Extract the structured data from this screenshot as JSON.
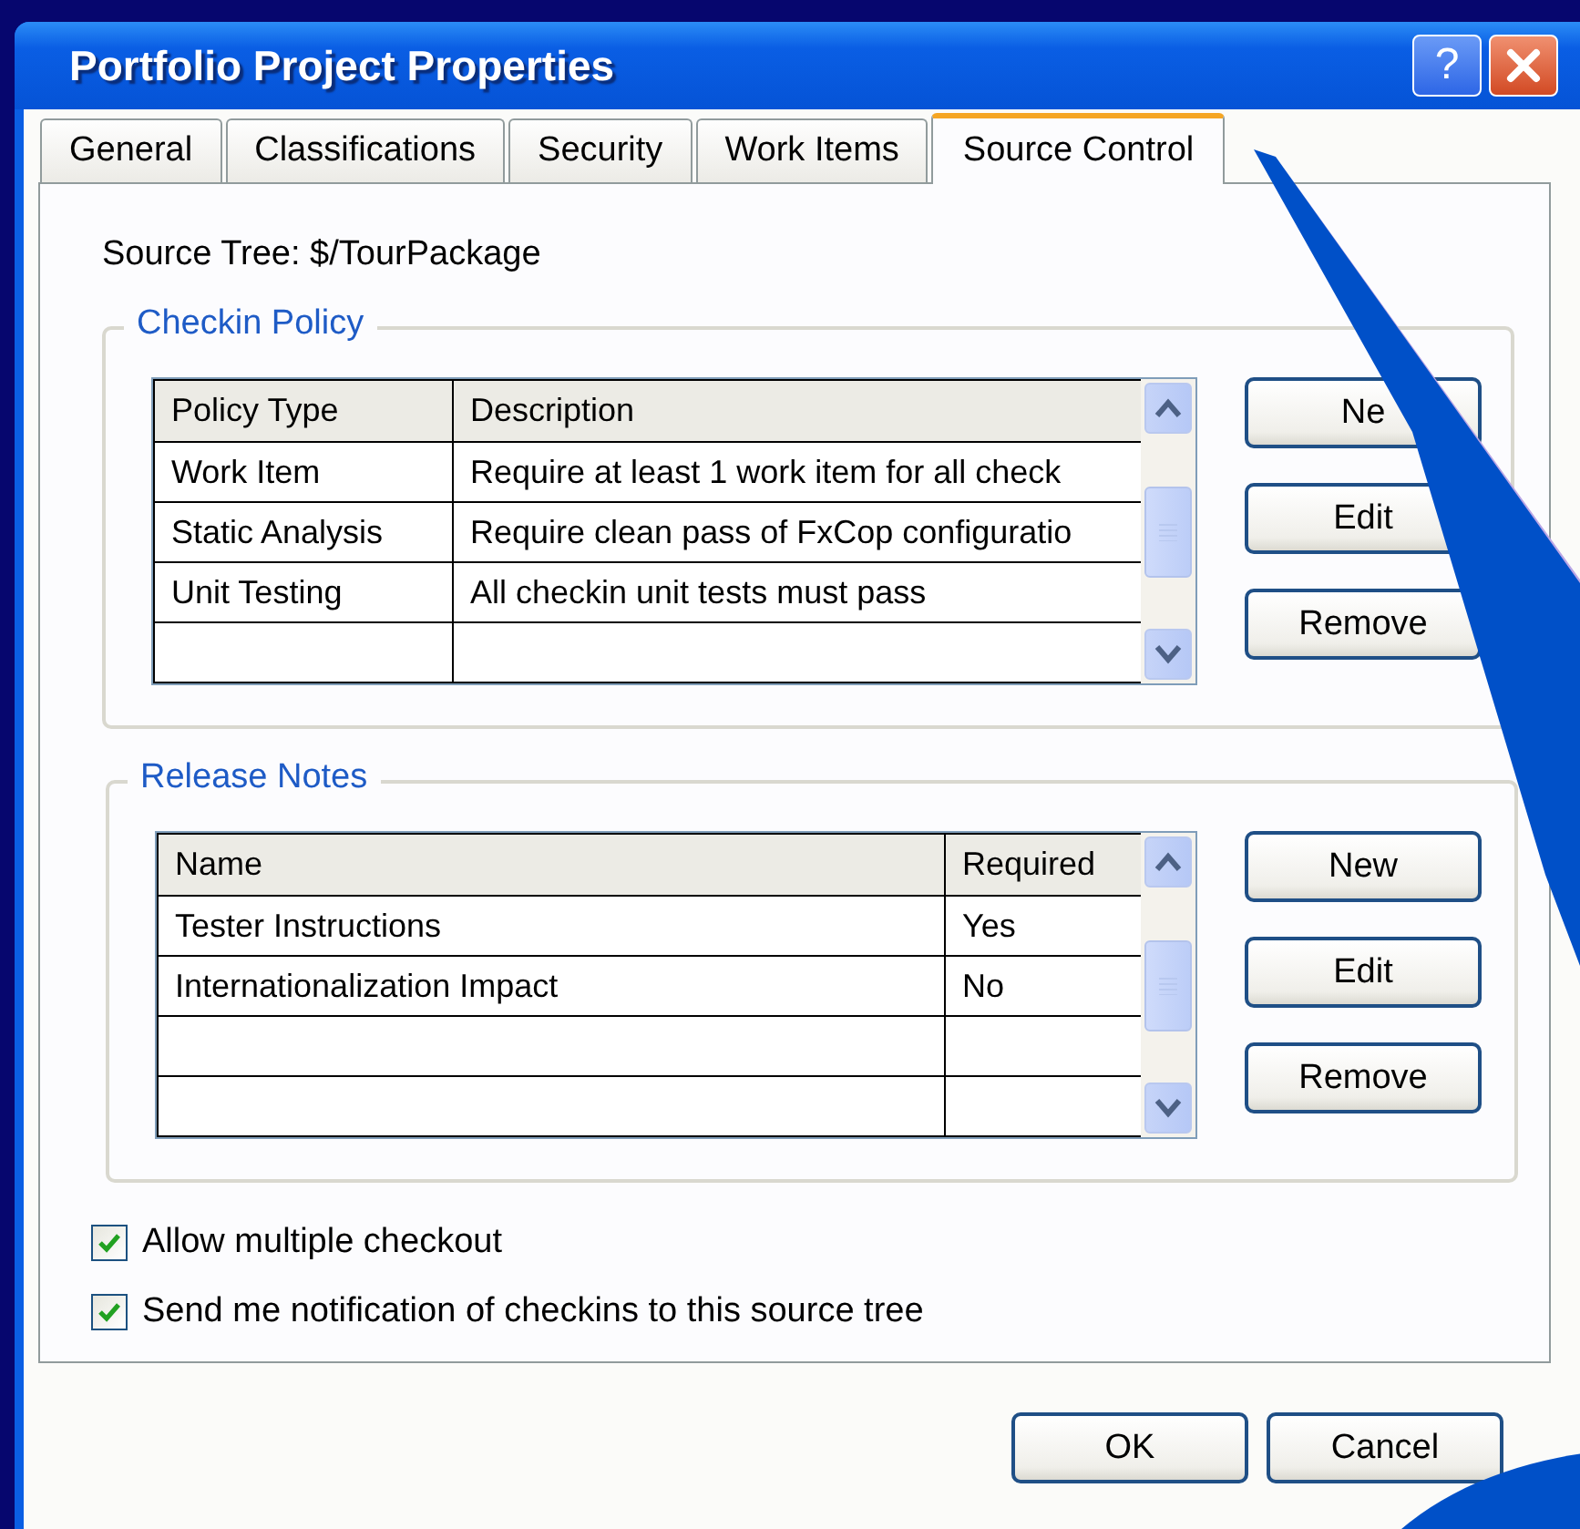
{
  "window": {
    "title": "Portfolio Project Properties",
    "help_button": "?"
  },
  "tabs": [
    {
      "label": "General",
      "selected": false
    },
    {
      "label": "Classifications",
      "selected": false
    },
    {
      "label": "Security",
      "selected": false
    },
    {
      "label": "Work Items",
      "selected": false
    },
    {
      "label": "Source Control",
      "selected": true
    }
  ],
  "source_tree": "Source Tree: $/TourPackage",
  "checkin_policy": {
    "title": "Checkin Policy",
    "columns": [
      "Policy Type",
      "Description"
    ],
    "rows": [
      [
        "Work Item",
        "Require at least 1 work item for all check"
      ],
      [
        "Static Analysis",
        "Require clean pass of FxCop configuratio"
      ],
      [
        "Unit Testing",
        "All checkin unit tests must pass"
      ]
    ],
    "buttons": [
      "Ne",
      "Edit",
      "Remove"
    ]
  },
  "release_notes": {
    "title": "Release Notes",
    "columns": [
      "Name",
      "Required"
    ],
    "rows": [
      [
        "Tester Instructions",
        "Yes"
      ],
      [
        "Internationalization Impact",
        "No"
      ]
    ],
    "buttons": [
      "New",
      "Edit",
      "Remove"
    ]
  },
  "options": [
    {
      "label": "Allow multiple checkout",
      "checked": true
    },
    {
      "label": "Send me notification of checkins to this source tree",
      "checked": true
    }
  ],
  "buttons": [
    "OK",
    "Cancel"
  ]
}
